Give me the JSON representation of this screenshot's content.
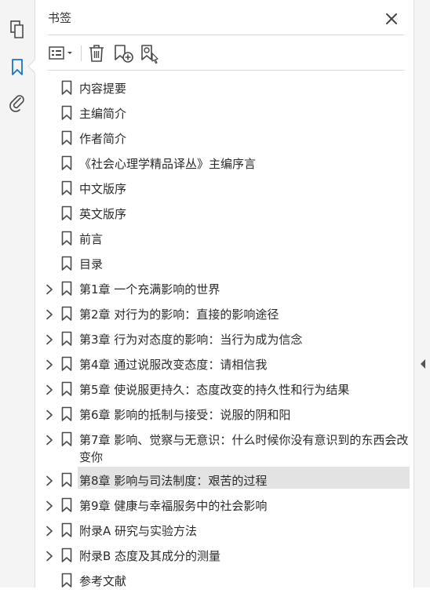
{
  "panel": {
    "title": "书签"
  },
  "toolbar": {
    "options_icon": "list-options-icon",
    "delete_icon": "trash-icon",
    "new_bookmark_icon": "new-bookmark-icon",
    "search_bookmark_icon": "find-bookmark-icon"
  },
  "rail": {
    "items": [
      "pages-icon",
      "bookmark-icon",
      "attachment-icon"
    ],
    "active": "bookmark-icon"
  },
  "colors": {
    "accent": "#1a73c8",
    "selected_row": "#e3e3e3"
  },
  "bookmarks": [
    {
      "label": "内容提要",
      "expandable": false
    },
    {
      "label": "主编简介",
      "expandable": false
    },
    {
      "label": "作者简介",
      "expandable": false
    },
    {
      "label": "《社会心理学精品译丛》主编序言",
      "expandable": false
    },
    {
      "label": "中文版序",
      "expandable": false
    },
    {
      "label": "英文版序",
      "expandable": false
    },
    {
      "label": "前言",
      "expandable": false
    },
    {
      "label": "目录",
      "expandable": false
    },
    {
      "label": "第1章 一个充满影响的世界",
      "expandable": true
    },
    {
      "label": "第2章 对行为的影响：直接的影响途径",
      "expandable": true
    },
    {
      "label": "第3章 行为对态度的影响：当行为成为信念",
      "expandable": true
    },
    {
      "label": "第4章 通过说服改变态度：请相信我",
      "expandable": true
    },
    {
      "label": "第5章 使说服更持久：态度改变的持久性和行为结果",
      "expandable": true
    },
    {
      "label": "第6章 影响的抵制与接受：说服的阴和阳",
      "expandable": true
    },
    {
      "label": "第7章 影响、觉察与无意识：什么时候你没有意识到的东西会改变你",
      "expandable": true
    },
    {
      "label": "第8章 影响与司法制度：艰苦的过程",
      "expandable": true,
      "selected": true
    },
    {
      "label": "第9章 健康与幸福服务中的社会影响",
      "expandable": true
    },
    {
      "label": "附录A 研究与实验方法",
      "expandable": true
    },
    {
      "label": "附录B 态度及其成分的测量",
      "expandable": true
    },
    {
      "label": "参考文献",
      "expandable": false
    }
  ]
}
